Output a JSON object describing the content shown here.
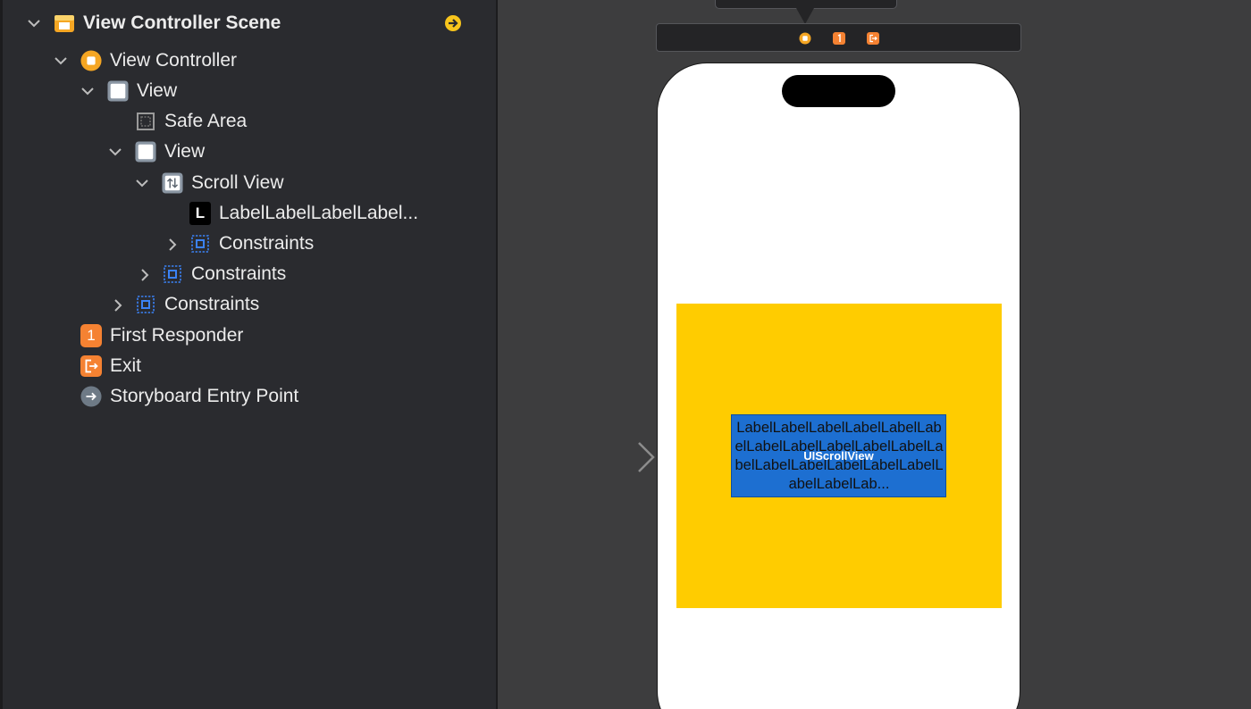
{
  "outline": {
    "items": [
      {
        "label": "View Controller Scene",
        "icon": "scene-icon",
        "expanded": true
      },
      {
        "label": "View Controller",
        "icon": "view-controller-icon",
        "expanded": true
      },
      {
        "label": "View",
        "icon": "view-icon",
        "expanded": true
      },
      {
        "label": "Safe Area",
        "icon": "safe-area-icon"
      },
      {
        "label": "View",
        "icon": "view-icon",
        "expanded": true
      },
      {
        "label": "Scroll View",
        "icon": "scroll-view-icon",
        "expanded": true
      },
      {
        "label": "LabelLabelLabelLabel...",
        "icon": "label-icon"
      },
      {
        "label": "Constraints",
        "icon": "constraints-icon",
        "expanded": false
      },
      {
        "label": "Constraints",
        "icon": "constraints-icon",
        "expanded": false
      },
      {
        "label": "Constraints",
        "icon": "constraints-icon",
        "expanded": false
      },
      {
        "label": "First Responder",
        "icon": "first-responder-icon"
      },
      {
        "label": "Exit",
        "icon": "exit-icon"
      },
      {
        "label": "Storyboard Entry Point",
        "icon": "entry-point-icon"
      }
    ],
    "label_icon_glyph": "L",
    "first_responder_glyph": "1",
    "scene_goto_icon": "arrow-right-circle-icon"
  },
  "canvas": {
    "scene_dock_icons": [
      "view-controller-icon",
      "first-responder-icon",
      "exit-icon"
    ],
    "scroll_view_tag": "UIScrollView",
    "label_text": "LabelLabelLabelLabelLabelLabelLabelLabelLabelLabelLabelLabelLabelLabelLabelLabelLabelLabelLabelLab...",
    "colors": {
      "container_background": "#ffcc00",
      "scroll_view_background": "#1d6fd1",
      "accent_orange": "#f5a623",
      "accent_yellow": "#f8c51c"
    }
  }
}
